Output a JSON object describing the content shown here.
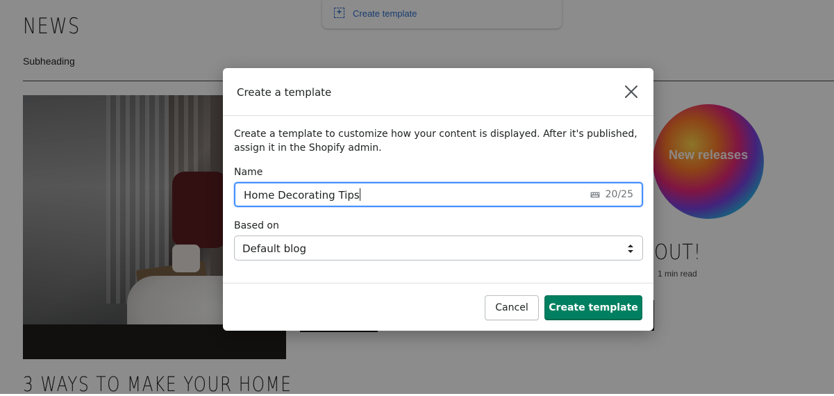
{
  "background": {
    "section_title": "NEWS",
    "subheading": "Subheading",
    "featured_image_label": "New releases",
    "article_title_fragment": "OUT!",
    "read_time": "1 min read",
    "article_title_bottom": "3 WAYS TO MAKE YOUR HOME",
    "top_menu_item": "Create template"
  },
  "modal": {
    "title": "Create a template",
    "description": "Create a template to customize how your content is displayed. After it's published, assign it in the Shopify admin.",
    "name_label": "Name",
    "name_value": "Home Decorating Tips",
    "name_counter": "20/25",
    "based_on_label": "Based on",
    "based_on_value": "Default blog",
    "cancel_label": "Cancel",
    "submit_label": "Create template"
  },
  "colors": {
    "primary": "#008060",
    "focus": "#458fff",
    "link": "#2c6ecb"
  },
  "icons": {
    "close": "close-icon",
    "keyboard": "keyboard-icon",
    "select": "select-arrows-icon",
    "add": "add-template-icon"
  }
}
